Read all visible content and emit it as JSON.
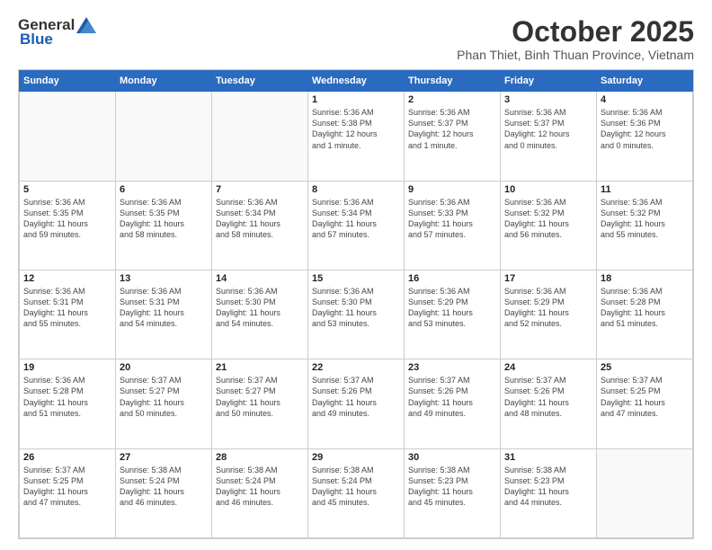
{
  "header": {
    "logo_general": "General",
    "logo_blue": "Blue",
    "month_year": "October 2025",
    "location": "Phan Thiet, Binh Thuan Province, Vietnam"
  },
  "days_of_week": [
    "Sunday",
    "Monday",
    "Tuesday",
    "Wednesday",
    "Thursday",
    "Friday",
    "Saturday"
  ],
  "weeks": [
    [
      {
        "day": "",
        "info": ""
      },
      {
        "day": "",
        "info": ""
      },
      {
        "day": "",
        "info": ""
      },
      {
        "day": "1",
        "info": "Sunrise: 5:36 AM\nSunset: 5:38 PM\nDaylight: 12 hours\nand 1 minute."
      },
      {
        "day": "2",
        "info": "Sunrise: 5:36 AM\nSunset: 5:37 PM\nDaylight: 12 hours\nand 1 minute."
      },
      {
        "day": "3",
        "info": "Sunrise: 5:36 AM\nSunset: 5:37 PM\nDaylight: 12 hours\nand 0 minutes."
      },
      {
        "day": "4",
        "info": "Sunrise: 5:36 AM\nSunset: 5:36 PM\nDaylight: 12 hours\nand 0 minutes."
      }
    ],
    [
      {
        "day": "5",
        "info": "Sunrise: 5:36 AM\nSunset: 5:35 PM\nDaylight: 11 hours\nand 59 minutes."
      },
      {
        "day": "6",
        "info": "Sunrise: 5:36 AM\nSunset: 5:35 PM\nDaylight: 11 hours\nand 58 minutes."
      },
      {
        "day": "7",
        "info": "Sunrise: 5:36 AM\nSunset: 5:34 PM\nDaylight: 11 hours\nand 58 minutes."
      },
      {
        "day": "8",
        "info": "Sunrise: 5:36 AM\nSunset: 5:34 PM\nDaylight: 11 hours\nand 57 minutes."
      },
      {
        "day": "9",
        "info": "Sunrise: 5:36 AM\nSunset: 5:33 PM\nDaylight: 11 hours\nand 57 minutes."
      },
      {
        "day": "10",
        "info": "Sunrise: 5:36 AM\nSunset: 5:32 PM\nDaylight: 11 hours\nand 56 minutes."
      },
      {
        "day": "11",
        "info": "Sunrise: 5:36 AM\nSunset: 5:32 PM\nDaylight: 11 hours\nand 55 minutes."
      }
    ],
    [
      {
        "day": "12",
        "info": "Sunrise: 5:36 AM\nSunset: 5:31 PM\nDaylight: 11 hours\nand 55 minutes."
      },
      {
        "day": "13",
        "info": "Sunrise: 5:36 AM\nSunset: 5:31 PM\nDaylight: 11 hours\nand 54 minutes."
      },
      {
        "day": "14",
        "info": "Sunrise: 5:36 AM\nSunset: 5:30 PM\nDaylight: 11 hours\nand 54 minutes."
      },
      {
        "day": "15",
        "info": "Sunrise: 5:36 AM\nSunset: 5:30 PM\nDaylight: 11 hours\nand 53 minutes."
      },
      {
        "day": "16",
        "info": "Sunrise: 5:36 AM\nSunset: 5:29 PM\nDaylight: 11 hours\nand 53 minutes."
      },
      {
        "day": "17",
        "info": "Sunrise: 5:36 AM\nSunset: 5:29 PM\nDaylight: 11 hours\nand 52 minutes."
      },
      {
        "day": "18",
        "info": "Sunrise: 5:36 AM\nSunset: 5:28 PM\nDaylight: 11 hours\nand 51 minutes."
      }
    ],
    [
      {
        "day": "19",
        "info": "Sunrise: 5:36 AM\nSunset: 5:28 PM\nDaylight: 11 hours\nand 51 minutes."
      },
      {
        "day": "20",
        "info": "Sunrise: 5:37 AM\nSunset: 5:27 PM\nDaylight: 11 hours\nand 50 minutes."
      },
      {
        "day": "21",
        "info": "Sunrise: 5:37 AM\nSunset: 5:27 PM\nDaylight: 11 hours\nand 50 minutes."
      },
      {
        "day": "22",
        "info": "Sunrise: 5:37 AM\nSunset: 5:26 PM\nDaylight: 11 hours\nand 49 minutes."
      },
      {
        "day": "23",
        "info": "Sunrise: 5:37 AM\nSunset: 5:26 PM\nDaylight: 11 hours\nand 49 minutes."
      },
      {
        "day": "24",
        "info": "Sunrise: 5:37 AM\nSunset: 5:26 PM\nDaylight: 11 hours\nand 48 minutes."
      },
      {
        "day": "25",
        "info": "Sunrise: 5:37 AM\nSunset: 5:25 PM\nDaylight: 11 hours\nand 47 minutes."
      }
    ],
    [
      {
        "day": "26",
        "info": "Sunrise: 5:37 AM\nSunset: 5:25 PM\nDaylight: 11 hours\nand 47 minutes."
      },
      {
        "day": "27",
        "info": "Sunrise: 5:38 AM\nSunset: 5:24 PM\nDaylight: 11 hours\nand 46 minutes."
      },
      {
        "day": "28",
        "info": "Sunrise: 5:38 AM\nSunset: 5:24 PM\nDaylight: 11 hours\nand 46 minutes."
      },
      {
        "day": "29",
        "info": "Sunrise: 5:38 AM\nSunset: 5:24 PM\nDaylight: 11 hours\nand 45 minutes."
      },
      {
        "day": "30",
        "info": "Sunrise: 5:38 AM\nSunset: 5:23 PM\nDaylight: 11 hours\nand 45 minutes."
      },
      {
        "day": "31",
        "info": "Sunrise: 5:38 AM\nSunset: 5:23 PM\nDaylight: 11 hours\nand 44 minutes."
      },
      {
        "day": "",
        "info": ""
      }
    ]
  ]
}
